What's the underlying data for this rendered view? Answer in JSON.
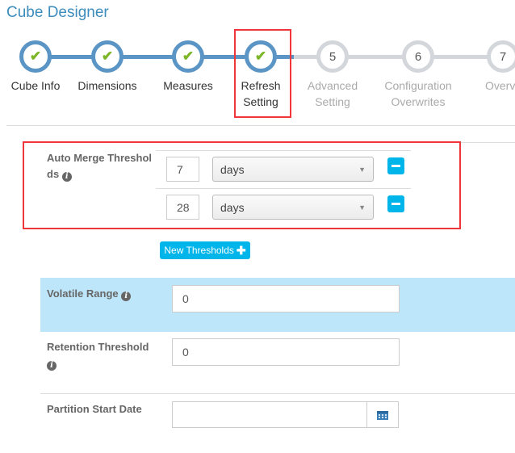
{
  "title": "Cube Designer",
  "steps": [
    {
      "label": "Cube Info",
      "done": true
    },
    {
      "label": "Dimensions",
      "done": true
    },
    {
      "label": "Measures",
      "done": true
    },
    {
      "label": "Refresh Setting",
      "line1": "Refresh",
      "line2": "Setting",
      "done": true
    },
    {
      "number": "5",
      "line1": "Advanced",
      "line2": "Setting",
      "done": false
    },
    {
      "number": "6",
      "line1": "Configuration",
      "line2": "Overwrites",
      "done": false
    },
    {
      "number": "7",
      "line1": "Overview",
      "done": false
    }
  ],
  "colors": {
    "accent": "#3c8dbc",
    "progress": "#5b95c5",
    "check": "#7cb628",
    "highlight": "#f0363a",
    "band": "#bde6fa",
    "button": "#00b5ea"
  },
  "auto_merge": {
    "label": "Auto Merge Thresholds",
    "label_line1": "Auto Merge Threshol",
    "label_line2": "ds",
    "rows": [
      {
        "value": "7",
        "unit": "days"
      },
      {
        "value": "28",
        "unit": "days"
      }
    ],
    "new_button": "New Thresholds"
  },
  "volatile": {
    "label": "Volatile Range",
    "value": "0"
  },
  "retention": {
    "label": "Retention Threshold",
    "value": "0"
  },
  "partition": {
    "label": "Partition Start Date",
    "value": ""
  }
}
